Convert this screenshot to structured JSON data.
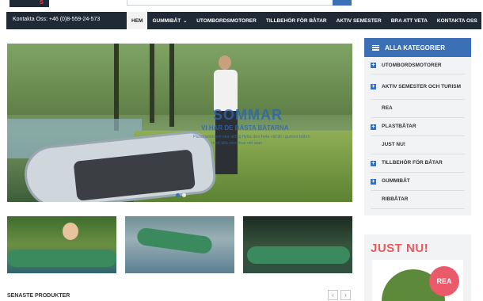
{
  "header": {
    "logo_text": "s"
  },
  "nav": {
    "contact": "Kontakta Oss: +46 (0)8-559-24-573",
    "items": [
      {
        "label": "HEM",
        "active": true,
        "dropdown": false
      },
      {
        "label": "GUMMIBÅT",
        "active": false,
        "dropdown": true
      },
      {
        "label": "UTOMBORDSMOTORER",
        "active": false,
        "dropdown": false
      },
      {
        "label": "TILLBEHÖR FÖR BÅTAR",
        "active": false,
        "dropdown": false
      },
      {
        "label": "AKTIV SEMESTER",
        "active": false,
        "dropdown": false
      },
      {
        "label": "BRA ATT VETA",
        "active": false,
        "dropdown": false
      },
      {
        "label": "KONTAKTA OSS",
        "active": false,
        "dropdown": false
      }
    ]
  },
  "slider": {
    "title": "SOMMAR",
    "subtitle": "VI HAR DE BÄSTA BÅTARNA",
    "text_line1": "Panoramintext ska aldrig flytta den hela vid till i gummi båten",
    "text_line2": "med alla utomhus vid utan",
    "dots": 2,
    "active_dot": 1
  },
  "latest": {
    "title": "SENASTE PRODUKTER",
    "prev": "‹",
    "next": "›"
  },
  "sidebar": {
    "title": "ALLA KATEGORIER",
    "categories": [
      {
        "label": "UTOMBORDSMOTORER",
        "expandable": true
      },
      {
        "label": "AKTIV SEMESTER OCH TURISM",
        "expandable": true
      },
      {
        "label": "REA",
        "expandable": false
      },
      {
        "label": "PLASTBÅTAR",
        "expandable": true
      },
      {
        "label": "JUST NU!",
        "expandable": false
      },
      {
        "label": "TILLBEHÖR FÖR BÅTAR",
        "expandable": true
      },
      {
        "label": "GUMMIBÅT",
        "expandable": true
      },
      {
        "label": "RIBBÅTAR",
        "expandable": false
      }
    ]
  },
  "promo": {
    "title": "JUST NU!",
    "badge": "REA"
  },
  "colors": {
    "navbar": "#1f2a36",
    "accent": "#3b6fb6",
    "promo": "#e8595c",
    "badge": "#ea5a6a"
  }
}
